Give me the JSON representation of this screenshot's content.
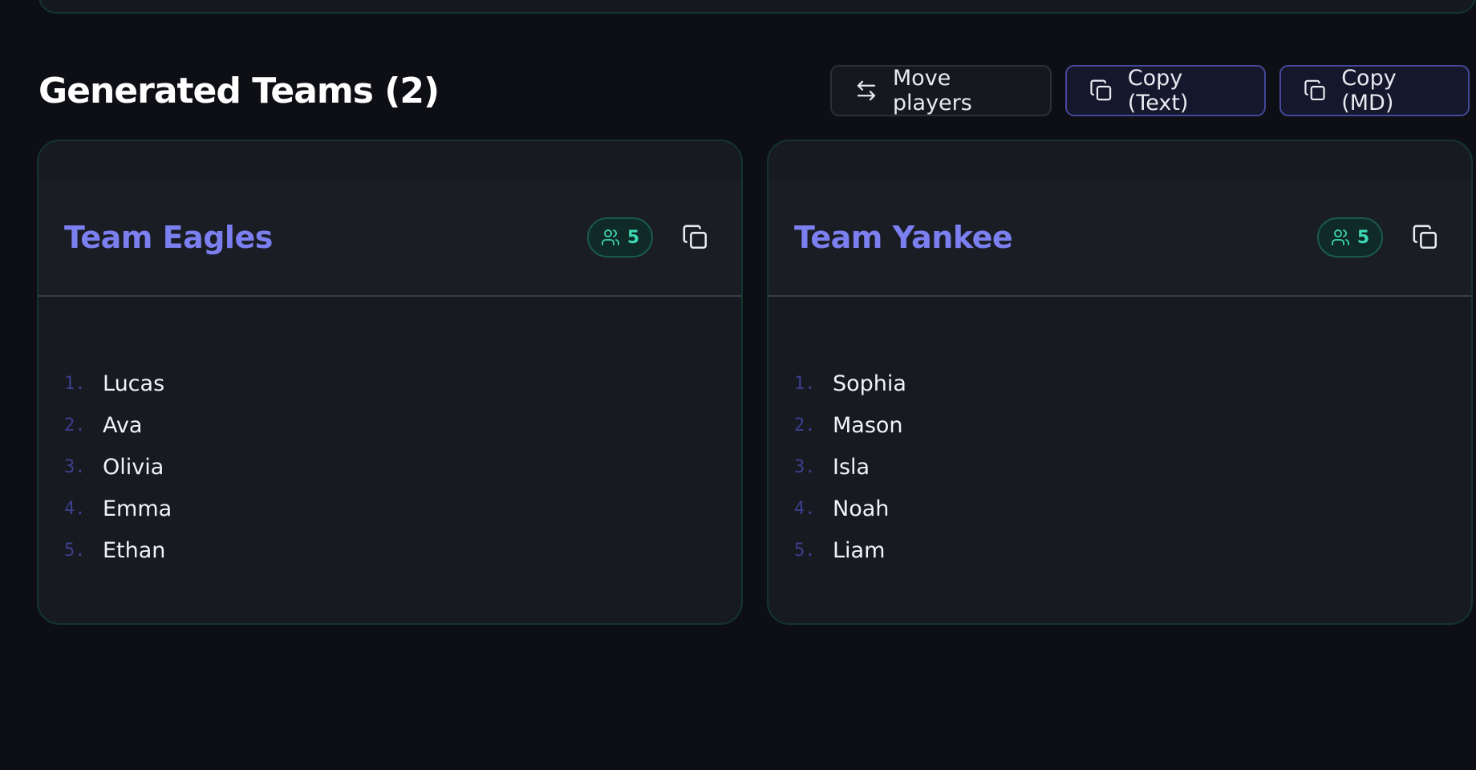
{
  "header": {
    "title": "Generated Teams (2)",
    "actions": {
      "move_label": "Move players",
      "copy_text_label": "Copy (Text)",
      "copy_md_label": "Copy (MD)"
    }
  },
  "colors": {
    "accent": "#7b7ff0",
    "badge": "#3dd9b4",
    "background": "#0d0f14",
    "card": "#181a21"
  },
  "teams": [
    {
      "name": "Team Eagles",
      "count": "5",
      "players": [
        {
          "num": "1.",
          "name": "Lucas"
        },
        {
          "num": "2.",
          "name": "Ava"
        },
        {
          "num": "3.",
          "name": "Olivia"
        },
        {
          "num": "4.",
          "name": "Emma"
        },
        {
          "num": "5.",
          "name": "Ethan"
        }
      ]
    },
    {
      "name": "Team Yankee",
      "count": "5",
      "players": [
        {
          "num": "1.",
          "name": "Sophia"
        },
        {
          "num": "2.",
          "name": "Mason"
        },
        {
          "num": "3.",
          "name": "Isla"
        },
        {
          "num": "4.",
          "name": "Noah"
        },
        {
          "num": "5.",
          "name": "Liam"
        }
      ]
    }
  ],
  "icons": {
    "move": "arrows-left-right-icon",
    "copy": "copy-icon",
    "users": "users-icon"
  }
}
